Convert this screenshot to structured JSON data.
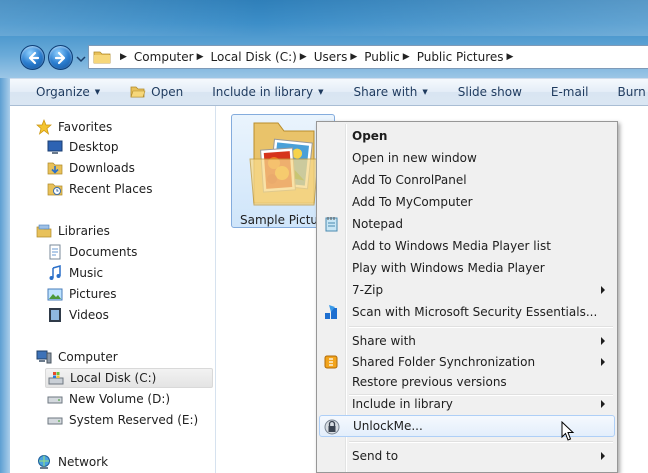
{
  "breadcrumb": [
    "Computer",
    "Local Disk (C:)",
    "Users",
    "Public",
    "Public Pictures"
  ],
  "toolbar": {
    "organize": "Organize",
    "open": "Open",
    "include_in_library": "Include in library",
    "share_with": "Share with",
    "slide_show": "Slide show",
    "email": "E-mail",
    "burn": "Burn"
  },
  "nav": {
    "favorites": "Favorites",
    "desktop": "Desktop",
    "downloads": "Downloads",
    "recent_places": "Recent Places",
    "libraries": "Libraries",
    "documents": "Documents",
    "music": "Music",
    "pictures": "Pictures",
    "videos": "Videos",
    "computer": "Computer",
    "local_disk": "Local Disk (C:)",
    "new_volume": "New Volume (D:)",
    "system_reserved": "System Reserved (E:)",
    "network": "Network"
  },
  "content": {
    "folder_name": "Sample Pictures"
  },
  "context_menu": {
    "open": "Open",
    "open_new_window": "Open in new window",
    "add_controlpanel": "Add To ConrolPanel",
    "add_mycomputer": "Add To MyComputer",
    "notepad": "Notepad",
    "add_wmp_list": "Add to Windows Media Player list",
    "play_wmp": "Play with Windows Media Player",
    "seven_zip": "7-Zip",
    "scan_mse": "Scan with Microsoft Security Essentials...",
    "share_with": "Share with",
    "shared_folder_sync": "Shared Folder Synchronization",
    "restore_versions": "Restore previous versions",
    "include_in_library": "Include in library",
    "unlockme": "UnlockMe...",
    "send_to": "Send to"
  },
  "colors": {
    "accent": "#2b7ed0",
    "toolbar_text": "#1e3a5e",
    "menu_hover_border": "#aecff7"
  }
}
